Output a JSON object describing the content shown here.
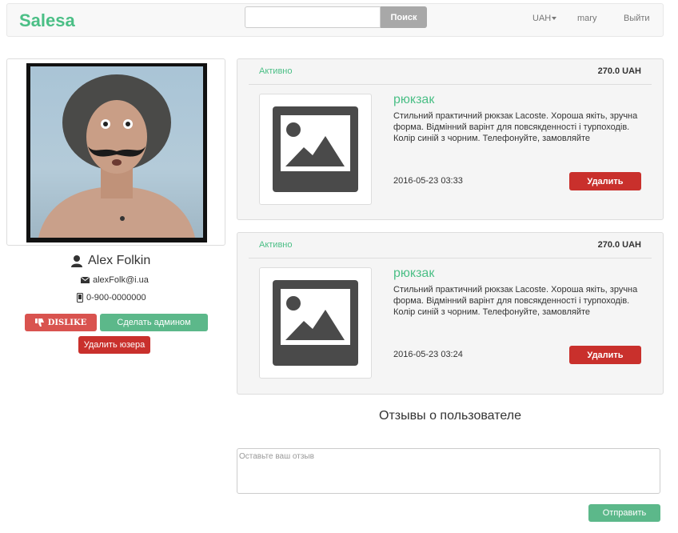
{
  "navbar": {
    "brand": "Salesa",
    "search_placeholder": "",
    "search_button": "Поиск",
    "currency": "UAH",
    "username": "mary",
    "logout": "Выйти"
  },
  "profile": {
    "name": "Alex Folkin",
    "email": "alexFolk@i.ua",
    "phone": "0-900-0000000",
    "dislike_label": "DISLIKE",
    "make_admin_label": "Сделать админом",
    "delete_user_label": "Удалить юзера"
  },
  "ads": [
    {
      "status": "Активно",
      "price": "270.0 UAH",
      "title": "рюкзак",
      "description": "Стильний практичний рюкзак Lacoste. Хороша якіть, зручна форма. Відмінний варінт для повсякденності і турпоходів. Колір синій з чорним. Телефонуйте, замовляйте",
      "date": "2016-05-23 03:33",
      "delete_label": "Удалить"
    },
    {
      "status": "Активно",
      "price": "270.0 UAH",
      "title": "рюкзак",
      "description": "Стильний практичний рюкзак Lacoste. Хороша якіть, зручна форма. Відмінний варінт для повсякденності і турпоходів. Колір синій з чорним. Телефонуйте, замовляйте",
      "date": "2016-05-23 03:24",
      "delete_label": "Удалить"
    }
  ],
  "reviews": {
    "title": "Отзывы о пользователе",
    "placeholder": "Оставьте ваш отзыв",
    "send_label": "Отправить"
  },
  "colors": {
    "brand": "#4bbf86",
    "danger": "#c9302c",
    "success": "#5cb88a"
  }
}
